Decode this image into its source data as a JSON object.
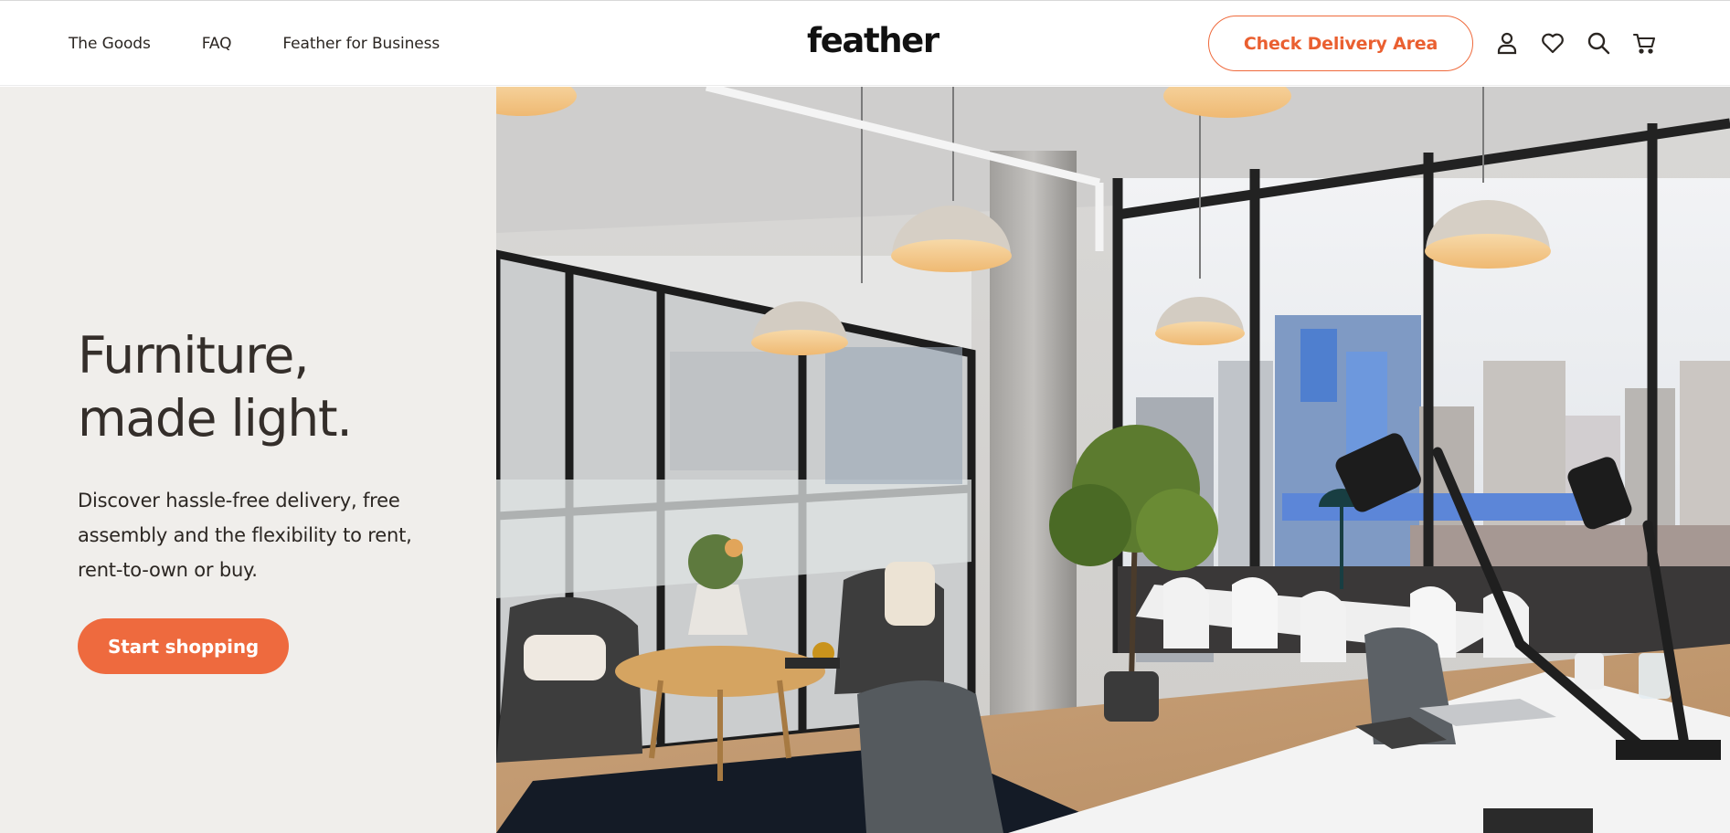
{
  "header": {
    "nav": [
      {
        "label": "The Goods"
      },
      {
        "label": "FAQ"
      },
      {
        "label": "Feather for Business"
      }
    ],
    "logo_text": "feather",
    "delivery_button": "Check Delivery Area",
    "icons": [
      "account-icon",
      "heart-icon",
      "search-icon",
      "cart-icon"
    ]
  },
  "hero": {
    "headline_line1": "Furniture,",
    "headline_line2": "made light.",
    "description": "Discover hassle-free delivery, free assembly and the flexibility to rent, rent-to-own or buy.",
    "cta": "Start shopping",
    "image_alt": "Modern office interior with pendant lamps, lounge chairs and city view"
  },
  "colors": {
    "accent": "#ee6a3e",
    "panel_bg": "#f0eeeb",
    "text": "#2b2622"
  }
}
